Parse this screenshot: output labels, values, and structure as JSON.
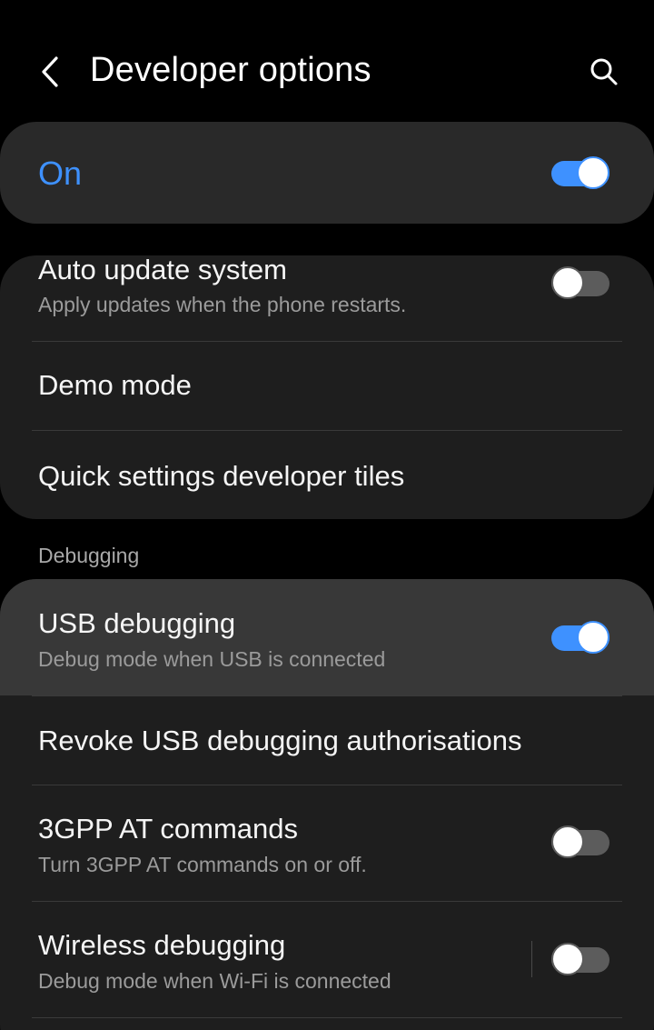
{
  "header": {
    "title": "Developer options",
    "back_icon": "chevron-left-icon",
    "search_icon": "search-icon"
  },
  "master_switch": {
    "label": "On",
    "state": "on"
  },
  "group1": {
    "items": [
      {
        "title": "Auto update system",
        "subtitle": "Apply updates when the phone restarts.",
        "toggle": "off"
      },
      {
        "title": "Demo mode"
      },
      {
        "title": "Quick settings developer tiles"
      }
    ]
  },
  "debugging": {
    "section_title": "Debugging",
    "items": [
      {
        "title": "USB debugging",
        "subtitle": "Debug mode when USB is connected",
        "toggle": "on"
      },
      {
        "title": "Revoke USB debugging authorisations"
      },
      {
        "title": "3GPP AT commands",
        "subtitle": "Turn 3GPP AT commands on or off.",
        "toggle": "off"
      },
      {
        "title": "Wireless debugging",
        "subtitle": "Debug mode when Wi-Fi is connected",
        "toggle": "off"
      }
    ]
  },
  "colors": {
    "accent": "#3e91ff",
    "background": "#000000",
    "card": "#1e1e1e",
    "master_card": "#292929",
    "highlight": "#383838"
  }
}
